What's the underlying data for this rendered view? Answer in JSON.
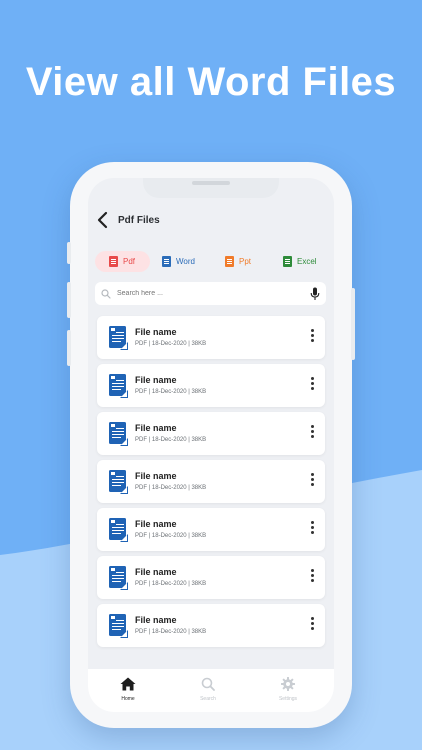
{
  "headline": "View all Word Files",
  "header": {
    "title": "Pdf Files"
  },
  "tabs": [
    {
      "label": "Pdf",
      "color": "#e84a4a",
      "active": true
    },
    {
      "label": "Word",
      "color": "#2b6cb8",
      "active": false
    },
    {
      "label": "Ppt",
      "color": "#f07b2a",
      "active": false
    },
    {
      "label": "Excel",
      "color": "#2e8b3a",
      "active": false
    }
  ],
  "search": {
    "placeholder": "Search here ..."
  },
  "files": [
    {
      "name": "File name",
      "meta": "PDF | 18-Dec-2020 | 38KB"
    },
    {
      "name": "File name",
      "meta": "PDF | 18-Dec-2020 | 38KB"
    },
    {
      "name": "File name",
      "meta": "PDF | 18-Dec-2020 | 38KB"
    },
    {
      "name": "File name",
      "meta": "PDF | 18-Dec-2020 | 38KB"
    },
    {
      "name": "File name",
      "meta": "PDF | 18-Dec-2020 | 38KB"
    },
    {
      "name": "File name",
      "meta": "PDF | 18-Dec-2020 | 38KB"
    },
    {
      "name": "File name",
      "meta": "PDF | 18-Dec-2020 | 38KB"
    }
  ],
  "bottom_nav": [
    {
      "label": "Home",
      "icon": "home-icon",
      "active": true
    },
    {
      "label": "Search",
      "icon": "search-icon",
      "active": false
    },
    {
      "label": "Settings",
      "icon": "gear-icon",
      "active": false
    }
  ],
  "colors": {
    "background": "#6fb0f6",
    "accent_blue": "#1f63b5",
    "active_tab_bg": "#fde2e4"
  }
}
